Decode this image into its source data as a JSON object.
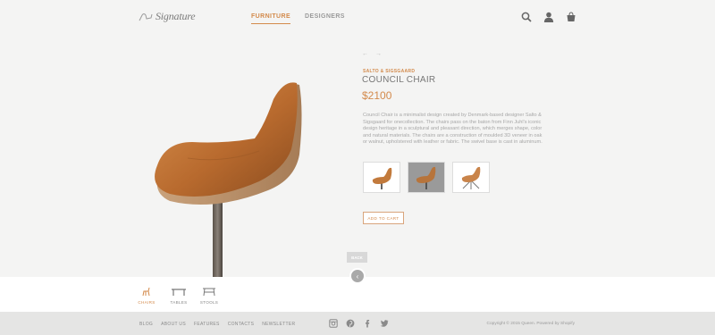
{
  "header": {
    "logo_text": "Signature",
    "nav": [
      {
        "label": "FURNITURE",
        "active": true
      },
      {
        "label": "DESIGNERS",
        "active": false
      }
    ],
    "icons": [
      "search-icon",
      "user-icon",
      "cart-icon"
    ]
  },
  "product": {
    "nav_prev": "←",
    "nav_next": "→",
    "brand": "SALTO & SIGSGAARD",
    "name": "COUNCIL CHAIR",
    "price": "$2100",
    "description": "Council Chair is a minimalist design created by Denmark-based designer Salto & Sigsgaard for onecollection. The chairs pass on the baton from Finn Juhl's iconic design heritage in a sculptural and pleasant direction, which merges shape, color and natural materials. The chairs are a construction of moulded 3D veneer in oak or walnut, upholstered with leather or fabric. The swivel base is cast in aluminum.",
    "add_to_cart": "ADD TO CART",
    "thumbnails": 3
  },
  "back_label": "BACK",
  "categories": [
    {
      "label": "CHAIRS",
      "active": true
    },
    {
      "label": "TABLES",
      "active": false
    },
    {
      "label": "STOOLS",
      "active": false
    }
  ],
  "footer": {
    "links": [
      "BLOG",
      "ABOUT US",
      "FEATURES",
      "CONTACTS",
      "NEWSLETTER"
    ],
    "social": [
      "instagram-icon",
      "pinterest-icon",
      "facebook-icon",
      "twitter-icon"
    ],
    "copyright": "Copyright © 2015 Queen. Powered by Shopify"
  },
  "colors": {
    "accent": "#d38a4b",
    "background": "#f4f4f3",
    "footer": "#e5e5e4"
  }
}
